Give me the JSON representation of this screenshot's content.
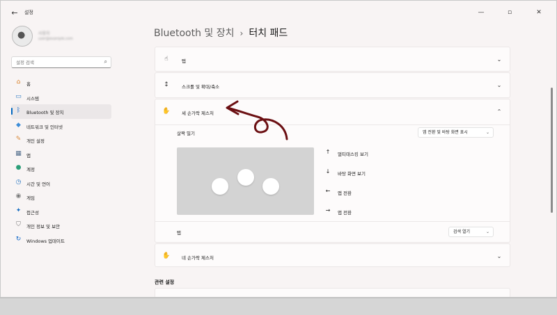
{
  "window": {
    "title": "설정",
    "back_icon": "arrow-left-icon",
    "controls": [
      "minimize-icon",
      "maximize-icon",
      "close-icon"
    ]
  },
  "sidebar": {
    "profile": {
      "name": "사용자",
      "email": "user@example.com"
    },
    "search": {
      "placeholder": "설정 검색",
      "icon": "search-icon"
    },
    "items": [
      {
        "label": "홈",
        "icon": "home-icon",
        "color": "#d9822b",
        "active": false
      },
      {
        "label": "시스템",
        "icon": "system-icon",
        "color": "#2b79c2",
        "active": false
      },
      {
        "label": "Bluetooth 및 장치",
        "icon": "bluetooth-icon",
        "color": "#0a63c7",
        "active": true
      },
      {
        "label": "네트워크 및 인터넷",
        "icon": "network-icon",
        "color": "#3d8dd8",
        "active": false
      },
      {
        "label": "개인 설정",
        "icon": "personalization-icon",
        "color": "#d98a3d",
        "active": false
      },
      {
        "label": "앱",
        "icon": "apps-icon",
        "color": "#4f6b8a",
        "active": false
      },
      {
        "label": "계정",
        "icon": "account-icon",
        "color": "#2b9e78",
        "active": false
      },
      {
        "label": "시간 및 언어",
        "icon": "time-language-icon",
        "color": "#2b79c2",
        "active": false
      },
      {
        "label": "게임",
        "icon": "gaming-icon",
        "color": "#7a7a7a",
        "active": false
      },
      {
        "label": "접근성",
        "icon": "accessibility-icon",
        "color": "#1a6fc2",
        "active": false
      },
      {
        "label": "개인 정보 및 보안",
        "icon": "privacy-shield-icon",
        "color": "#6f6f6f",
        "active": false
      },
      {
        "label": "Windows 업데이트",
        "icon": "windows-update-icon",
        "color": "#0a63c7",
        "active": false
      }
    ]
  },
  "breadcrumb": {
    "parent": "Bluetooth 및 장치",
    "separator": "›",
    "current": "터치 패드"
  },
  "cards": {
    "tap": {
      "label": "탭",
      "icon": "tap-hand-icon",
      "expanded": false
    },
    "scroll_zoom": {
      "label": "스크롤 및 확대/축소",
      "icon": "scroll-icon",
      "expanded": false
    },
    "three_finger": {
      "label": "세 손가락 제스처",
      "icon": "three-finger-hand-icon",
      "expanded": true,
      "swipe": {
        "label": "살짝 밀기",
        "value": "앱 전환 및 바탕 화면 표시"
      },
      "gestures": [
        {
          "icon": "arrow-up-icon",
          "label": "멀티태스킹 보기"
        },
        {
          "icon": "arrow-down-icon",
          "label": "바탕 화면 보기"
        },
        {
          "icon": "arrow-left-icon",
          "label": "앱 전환"
        },
        {
          "icon": "arrow-right-icon",
          "label": "앱 전환"
        }
      ],
      "tap": {
        "label": "탭",
        "value": "검색 열기"
      }
    },
    "four_finger": {
      "label": "네 손가락 제스처",
      "icon": "four-finger-hand-icon",
      "expanded": false
    }
  },
  "related": {
    "title": "관련 설정"
  },
  "colors": {
    "accent": "#0067c0",
    "annotation": "#6b0f12"
  }
}
